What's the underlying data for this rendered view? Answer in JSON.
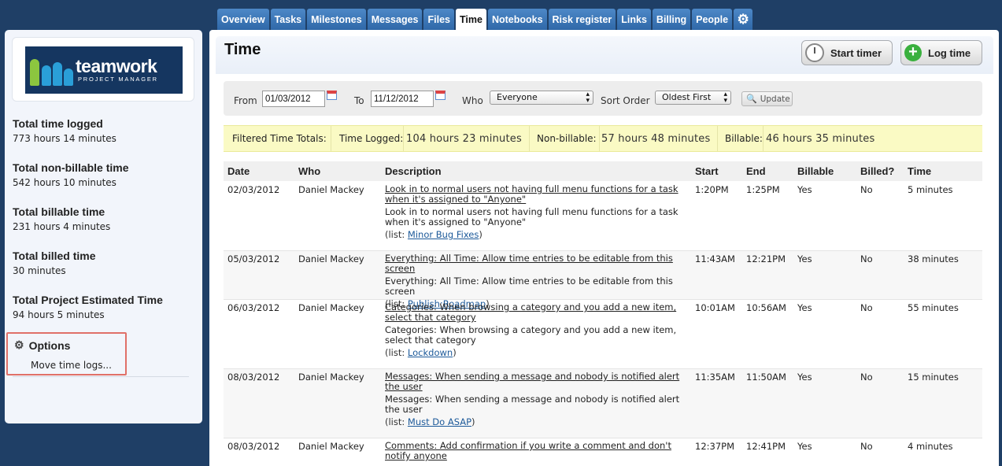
{
  "tabs": [
    {
      "label": "Overview",
      "active": false
    },
    {
      "label": "Tasks",
      "active": false
    },
    {
      "label": "Milestones",
      "active": false
    },
    {
      "label": "Messages",
      "active": false
    },
    {
      "label": "Files",
      "active": false
    },
    {
      "label": "Time",
      "active": true
    },
    {
      "label": "Notebooks",
      "active": false
    },
    {
      "label": "Risk register",
      "active": false
    },
    {
      "label": "Links",
      "active": false
    },
    {
      "label": "Billing",
      "active": false
    },
    {
      "label": "People",
      "active": false
    }
  ],
  "settings_icon": "gear-icon",
  "logo": {
    "name": "teamwork",
    "tagline": "PROJECT MANAGER"
  },
  "sidebar": {
    "stats": [
      {
        "title": "Total time logged",
        "value": "773 hours 14 minutes"
      },
      {
        "title": "Total non-billable time",
        "value": "542 hours 10 minutes"
      },
      {
        "title": "Total billable time",
        "value": "231 hours 4 minutes"
      },
      {
        "title": "Total billed time",
        "value": "30 minutes"
      },
      {
        "title": "Total Project Estimated Time",
        "value": "94 hours 5 minutes"
      }
    ],
    "options": {
      "title": "Options",
      "link": "Move time logs..."
    }
  },
  "main": {
    "title": "Time",
    "start_timer": "Start timer",
    "log_time": "Log time"
  },
  "filters": {
    "from_label": "From",
    "from_value": "01/03/2012",
    "to_label": "To",
    "to_value": "11/12/2012",
    "who_label": "Who",
    "who_value": "Everyone",
    "sort_label": "Sort Order",
    "sort_value": "Oldest First",
    "update_label": "Update"
  },
  "totals": {
    "label": "Filtered Time Totals:",
    "logged_label": "Time Logged:",
    "logged_value": "104 hours 23 minutes",
    "nonbillable_label": "Non-billable:",
    "nonbillable_value": "57 hours 48 minutes",
    "billable_label": "Billable:",
    "billable_value": "46 hours 35 minutes"
  },
  "table": {
    "headers": [
      "Date",
      "Who",
      "Description",
      "Start",
      "End",
      "Billable",
      "Billed?",
      "Time"
    ],
    "rows": [
      {
        "date": "02/03/2012",
        "who": "Daniel Mackey",
        "title": "Look in to normal users not having full menu functions for a task when it's assigned to \"Anyone\"",
        "text": "Look in to normal users not having full menu functions for a task when it's assigned to \"Anyone\"",
        "list_prefix": "(list: ",
        "list": "Minor Bug Fixes",
        "list_suffix": ")",
        "start": "1:20PM",
        "end": "1:25PM",
        "billable": "Yes",
        "billed": "No",
        "time": "5 minutes"
      },
      {
        "date": "05/03/2012",
        "who": "Daniel Mackey",
        "title": "Everything: All Time: Allow time entries to be editable from this screen",
        "text": "Everything: All Time: Allow time entries to be editable from this screen",
        "list_prefix": "(list: ",
        "list": "Publish:Roadmap",
        "list_suffix": ")",
        "start": "11:43AM",
        "end": "12:21PM",
        "billable": "Yes",
        "billed": "No",
        "time": "38 minutes"
      },
      {
        "date": "06/03/2012",
        "who": "Daniel Mackey",
        "title": "Categories: When browsing a category and you add a new item, select that category",
        "text": "Categories: When browsing a category and you add a new item, select that category",
        "list_prefix": "(list: ",
        "list": "Lockdown",
        "list_suffix": ")",
        "start": "10:01AM",
        "end": "10:56AM",
        "billable": "Yes",
        "billed": "No",
        "time": "55 minutes"
      },
      {
        "date": "08/03/2012",
        "who": "Daniel Mackey",
        "title": "Messages: When sending a message and nobody is notified alert the user",
        "text": "Messages: When sending a message and nobody is notified alert the user",
        "list_prefix": "(list: ",
        "list": "Must Do ASAP",
        "list_suffix": ")",
        "start": "11:35AM",
        "end": "11:50AM",
        "billable": "Yes",
        "billed": "No",
        "time": "15 minutes"
      },
      {
        "date": "08/03/2012",
        "who": "Daniel Mackey",
        "title": "Comments: Add confirmation if you write a comment and don't notify anyone",
        "start": "12:37PM",
        "end": "12:41PM",
        "billable": "Yes",
        "billed": "No",
        "time": "4 minutes"
      }
    ]
  }
}
